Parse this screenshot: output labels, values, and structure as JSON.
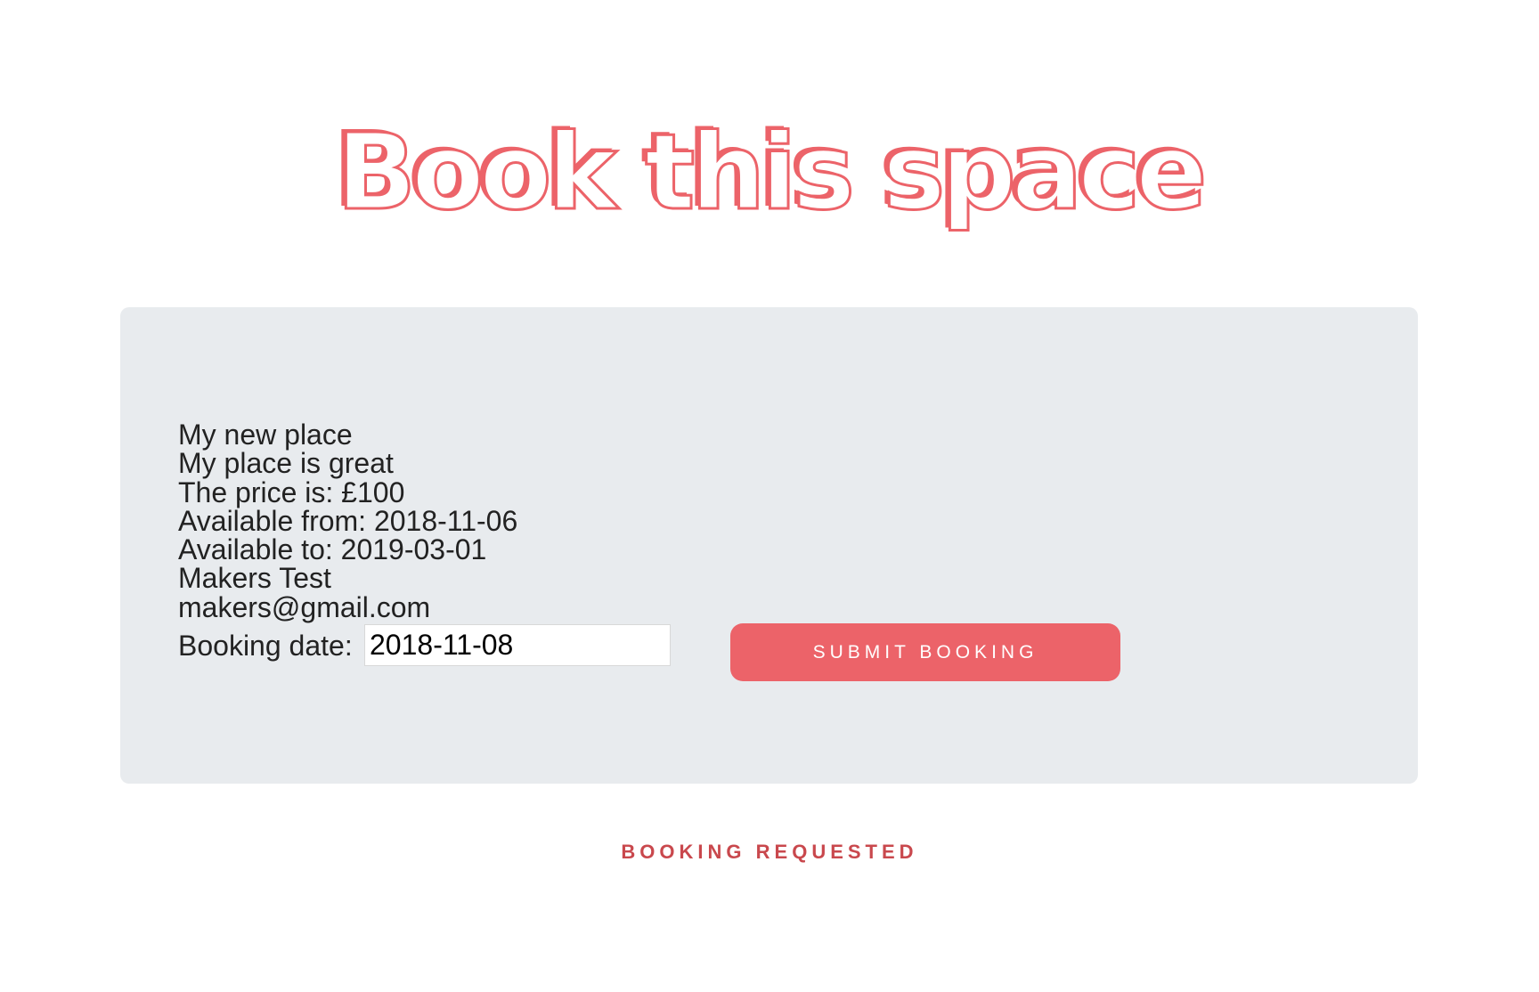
{
  "header": {
    "title": "Book this space"
  },
  "listing": {
    "name": "My new place",
    "description": "My place is great",
    "price": "The price is: £100",
    "available_from": "Available from: 2018-11-06",
    "available_to": "Available to: 2019-03-01",
    "owner_name": "Makers Test",
    "owner_email": "makers@gmail.com"
  },
  "booking_form": {
    "date_label": "Booking date:",
    "date_value": "2018-11-08",
    "submit_label": "Submit booking"
  },
  "status": {
    "message": "Booking requested"
  },
  "colors": {
    "accent": "#ec6369",
    "card_background": "#e8ebee",
    "status_text": "#c9484d"
  }
}
